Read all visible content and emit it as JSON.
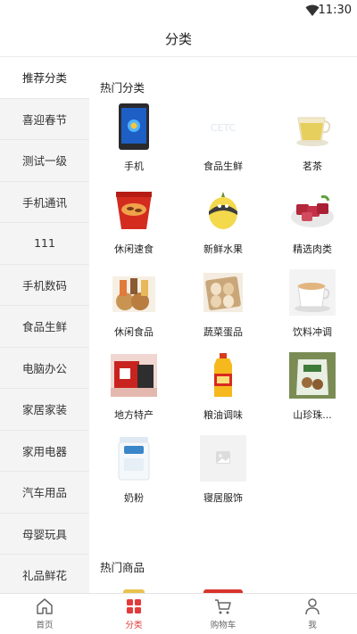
{
  "status_bar": {
    "time": "11:30",
    "icons": [
      "wifi-icon"
    ]
  },
  "header": {
    "title": "分类"
  },
  "sidebar": {
    "items": [
      {
        "label": "推荐分类",
        "active": true
      },
      {
        "label": "喜迎春节"
      },
      {
        "label": "测试一级"
      },
      {
        "label": "手机通讯"
      },
      {
        "label": "111"
      },
      {
        "label": "手机数码"
      },
      {
        "label": "食品生鲜"
      },
      {
        "label": "电脑办公"
      },
      {
        "label": "家居家装"
      },
      {
        "label": "家用电器"
      },
      {
        "label": "汽车用品"
      },
      {
        "label": "母婴玩具"
      },
      {
        "label": "礼品鲜花"
      }
    ]
  },
  "content": {
    "hot_categories_title": "热门分类",
    "hot_categories": [
      {
        "label": "手机",
        "icon": "phone-image"
      },
      {
        "label": "食品生鲜",
        "icon": "cetc-logo-image"
      },
      {
        "label": "茗茶",
        "icon": "tea-cup-image"
      },
      {
        "label": "休闲速食",
        "icon": "instant-noodle-image"
      },
      {
        "label": "新鲜水果",
        "icon": "melon-image"
      },
      {
        "label": "精选肉类",
        "icon": "meat-image"
      },
      {
        "label": "休闲食品",
        "icon": "snack-image"
      },
      {
        "label": "蔬菜蛋品",
        "icon": "eggs-image"
      },
      {
        "label": "饮料冲调",
        "icon": "milk-tea-image"
      },
      {
        "label": "地方特产",
        "icon": "specialty-image"
      },
      {
        "label": "粮油调味",
        "icon": "oil-bottle-image"
      },
      {
        "label": "山珍珠...",
        "icon": "mushroom-bag-image"
      },
      {
        "label": "奶粉",
        "icon": "milk-powder-image"
      },
      {
        "label": "寝居服饰",
        "icon": "placeholder-image"
      }
    ],
    "hot_products_title": "热门商品"
  },
  "tabbar": {
    "items": [
      {
        "label": "首页",
        "icon": "home-icon"
      },
      {
        "label": "分类",
        "icon": "category-icon",
        "active": true
      },
      {
        "label": "购物车",
        "icon": "cart-icon"
      },
      {
        "label": "我",
        "icon": "user-icon"
      }
    ],
    "active_color": "#e23b3b"
  }
}
